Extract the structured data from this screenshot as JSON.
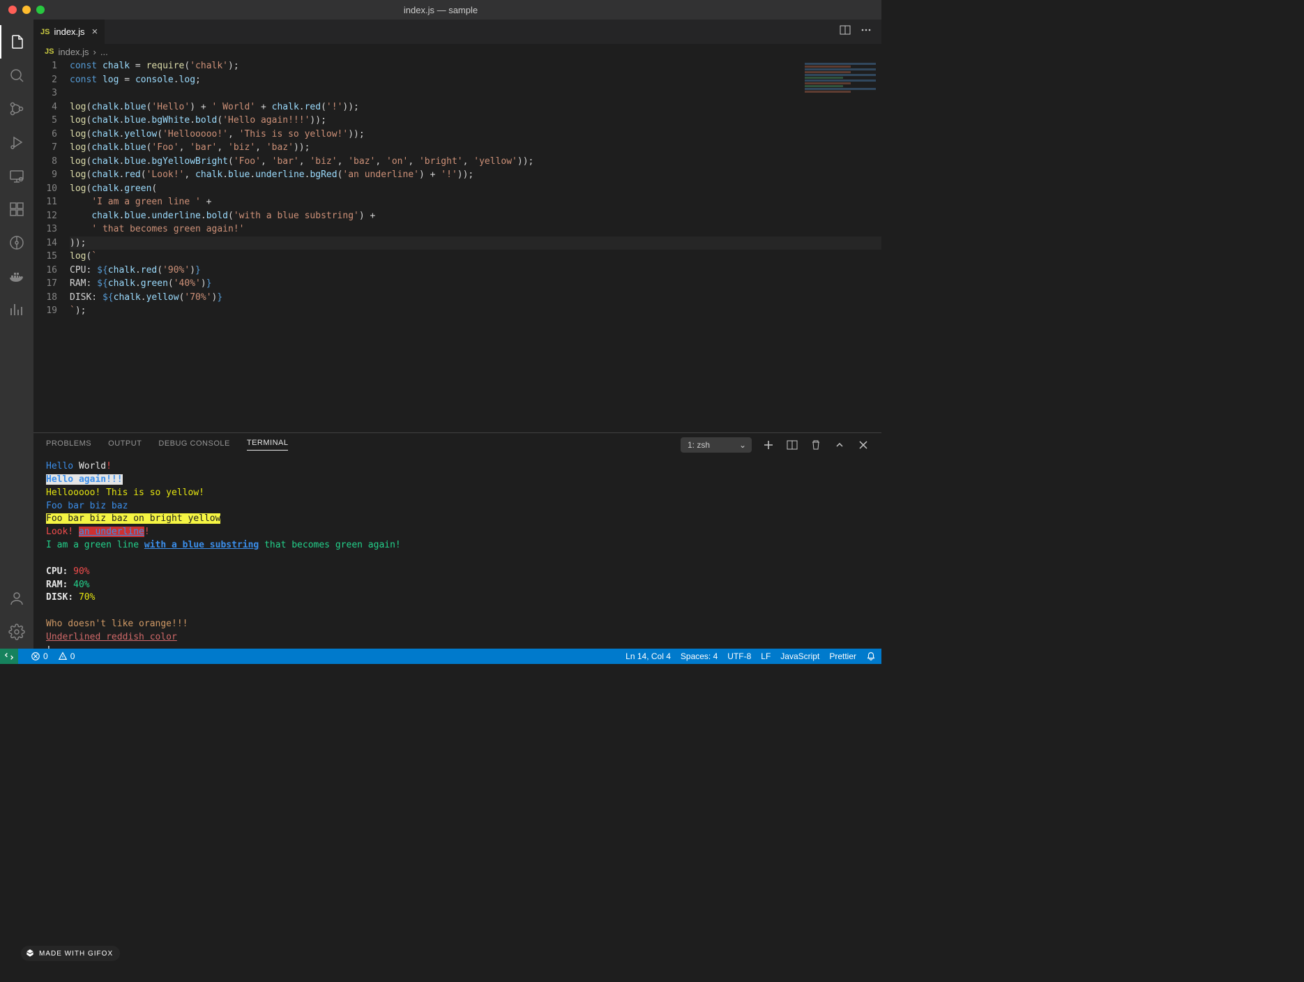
{
  "window": {
    "title": "index.js — sample"
  },
  "tab": {
    "filename": "index.js",
    "icon": "JS"
  },
  "breadcrumb": {
    "filename": "index.js",
    "sep": "›",
    "more": "..."
  },
  "code_lines": {
    "count": 19
  },
  "panel": {
    "tabs": {
      "problems": "PROBLEMS",
      "output": "OUTPUT",
      "debug": "DEBUG CONSOLE",
      "terminal": "TERMINAL"
    },
    "shell": "1: zsh"
  },
  "terminal": {
    "l1_hello": "Hello",
    "l1_world": " World",
    "l1_bang": "!",
    "l2": "Hello again!!!",
    "l3": "Hellooooo! This is so yellow!",
    "l4": "Foo bar biz baz",
    "l5": "Foo bar biz baz on bright yellow",
    "l6_look": "Look! ",
    "l6_under": "an underline",
    "l6_bang": "!",
    "l7_a": "I am a green line ",
    "l7_b": "with a blue substring",
    "l7_c": " that becomes green again!",
    "cpu_label": "CPU: ",
    "cpu_val": "90%",
    "ram_label": "RAM: ",
    "ram_val": "40%",
    "disk_label": "DISK: ",
    "disk_val": "70%",
    "orange": "Who doesn't like orange!!!",
    "reddish": "Underlined reddish color",
    "last_bang": "!"
  },
  "status": {
    "errors": "0",
    "warnings": "0",
    "position": "Ln 14, Col 4",
    "spaces": "Spaces: 4",
    "encoding": "UTF-8",
    "eol": "LF",
    "language": "JavaScript",
    "formatter": "Prettier"
  },
  "badge": {
    "text": "MADE WITH GIFOX"
  },
  "code": {
    "l1": {
      "a": "const ",
      "b": "chalk",
      "c": " = ",
      "d": "require",
      "e": "(",
      "f": "'chalk'",
      "g": ");"
    },
    "l2": {
      "a": "const ",
      "b": "log",
      "c": " = ",
      "d": "console",
      "e": ".",
      "f": "log",
      "g": ";"
    },
    "l4": "log(chalk.blue('Hello') + ' World' + chalk.red('!'));",
    "l5": "log(chalk.blue.bgWhite.bold('Hello again!!!'));",
    "l6": "log(chalk.yellow('Hellooooo!', 'This is so yellow!'));",
    "l7": "log(chalk.blue('Foo', 'bar', 'biz', 'baz'));",
    "l8": "log(chalk.blue.bgYellowBright('Foo', 'bar', 'biz', 'baz', 'on', 'bright', 'yellow'));",
    "l9": "log(chalk.red('Look!', chalk.blue.underline.bgRed('an underline') + '!'));",
    "l10": "log(chalk.green(",
    "l11": "    'I am a green line ' +",
    "l12": "    chalk.blue.underline.bold('with a blue substring') +",
    "l13": "    ' that becomes green again!'",
    "l14": "));",
    "l15": "log(`",
    "l16": "CPU: ${chalk.red('90%')}",
    "l17": "RAM: ${chalk.green('40%')}",
    "l18": "DISK: ${chalk.yellow('70%')}",
    "l19": "`);"
  }
}
